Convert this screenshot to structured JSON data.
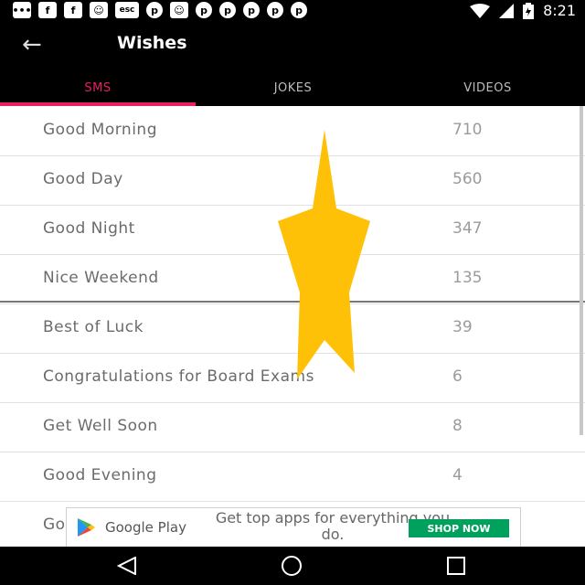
{
  "status_bar": {
    "time": "8:21",
    "icons": [
      "chat-icon",
      "facebook-icon",
      "facebook-icon",
      "cat-icon",
      "esc-icon",
      "pinterest-icon",
      "cat-icon",
      "pinterest-icon",
      "pinterest-icon",
      "pinterest-icon",
      "pinterest-icon",
      "pinterest-icon",
      "wifi-icon",
      "signal-icon",
      "battery-icon"
    ],
    "esc_label": "esc"
  },
  "app_bar": {
    "title": "Wishes",
    "back_icon": "arrow-left-icon"
  },
  "tabs": [
    {
      "label": "SMS",
      "active": true
    },
    {
      "label": "JOKES",
      "active": false
    },
    {
      "label": "VIDEOS",
      "active": false
    }
  ],
  "list": [
    {
      "label": "Good Morning",
      "count": "710"
    },
    {
      "label": "Good Day",
      "count": "560"
    },
    {
      "label": "Good Night",
      "count": "347"
    },
    {
      "label": "Nice Weekend",
      "count": "135"
    },
    {
      "label": "Best of Luck",
      "count": "39"
    },
    {
      "label": "Congratulations for Board Exams",
      "count": "6"
    },
    {
      "label": "Get Well Soon",
      "count": "8"
    },
    {
      "label": "Good Evening",
      "count": "4"
    },
    {
      "label": "Go",
      "count": ""
    }
  ],
  "ad": {
    "brand": "Google Play",
    "tagline": "Get top apps for everything you do.",
    "cta": "SHOP NOW"
  },
  "colors": {
    "accent": "#e91e63",
    "overlay_star": "#ffc107",
    "ad_cta": "#00a15c"
  }
}
